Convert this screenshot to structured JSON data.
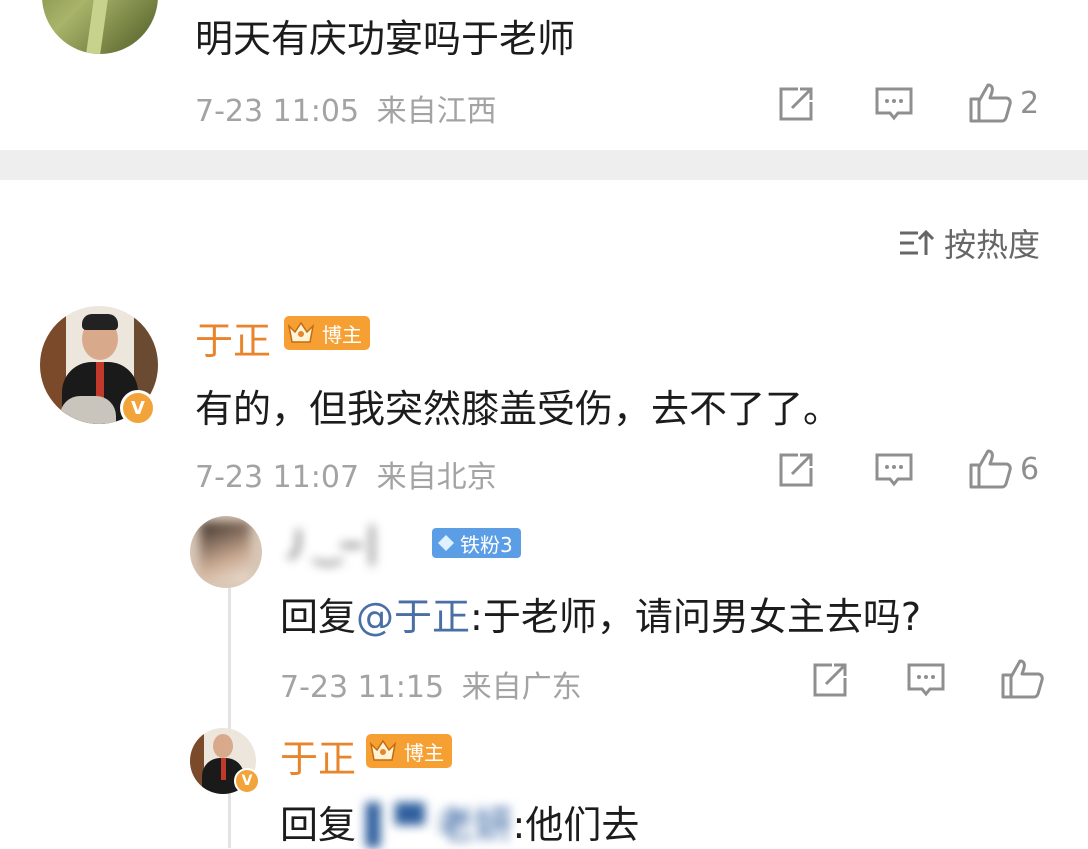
{
  "top_comment": {
    "text": "明天有庆功宴吗于老师",
    "time": "7-23 11:05",
    "location": "来自江西",
    "likes": "2"
  },
  "sort": {
    "label": "按热度"
  },
  "main_comment": {
    "author": "于正",
    "badge": "博主",
    "text": "有的，但我突然膝盖受伤，去不了了。",
    "time": "7-23 11:07",
    "location": "来自北京",
    "likes": "6"
  },
  "reply1": {
    "author": "丿‿─│",
    "fan_badge": "铁粉3",
    "prefix": "回复",
    "mention": "@于正",
    "text": ":于老师，请问男女主去吗?",
    "time": "7-23 11:15",
    "location": "来自广东"
  },
  "reply2": {
    "author": "于正",
    "badge": "博主",
    "prefix": "回复",
    "mention": "▌▀ 老妍",
    "text": ":他们去"
  },
  "colors": {
    "accent": "#e8842c",
    "mention": "#4a6fa5",
    "meta": "#a3a3a3"
  }
}
